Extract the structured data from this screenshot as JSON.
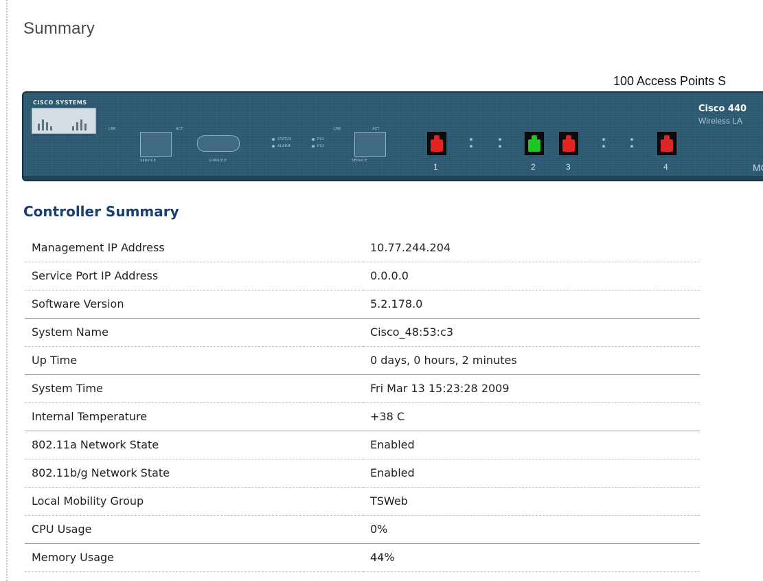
{
  "page": {
    "title": "Summary"
  },
  "chassis": {
    "ap_support": "100 Access Points S",
    "brand": "CISCO SYSTEMS",
    "model": "Cisco 440",
    "model_sub": "Wireless LA",
    "model_code": "MC",
    "port_labels": {
      "service": "SERVICE",
      "console": "CONSOLE",
      "lnk": "LNK",
      "act": "ACT",
      "status": "STATUS",
      "alarm": "ALARM",
      "ps1": "PS1",
      "ps2": "PS2"
    },
    "ports": [
      {
        "number": "1",
        "status": "red"
      },
      {
        "number": "2",
        "status": "green"
      },
      {
        "number": "3",
        "status": "red"
      },
      {
        "number": "4",
        "status": "red"
      }
    ],
    "colors": {
      "panel": "#2b5870",
      "port_up": "#21c421",
      "port_down": "#e02424"
    }
  },
  "controller_summary": {
    "title": "Controller Summary",
    "rows": [
      {
        "label": "Management IP Address",
        "value": "10.77.244.204"
      },
      {
        "label": "Service Port IP Address",
        "value": "0.0.0.0"
      },
      {
        "label": "Software Version",
        "value": "5.2.178.0"
      },
      {
        "label": "System Name",
        "value": "Cisco_48:53:c3"
      },
      {
        "label": "Up Time",
        "value": "0 days, 0 hours, 2 minutes"
      },
      {
        "label": "System Time",
        "value": "Fri Mar 13 15:23:28 2009"
      },
      {
        "label": "Internal Temperature",
        "value": "+38 C"
      },
      {
        "label": "802.11a Network State",
        "value": "Enabled"
      },
      {
        "label": "802.11b/g Network State",
        "value": "Enabled"
      },
      {
        "label": "Local Mobility Group",
        "value": "TSWeb"
      },
      {
        "label": "CPU Usage",
        "value": "0%"
      },
      {
        "label": "Memory Usage",
        "value": "44%"
      }
    ]
  }
}
